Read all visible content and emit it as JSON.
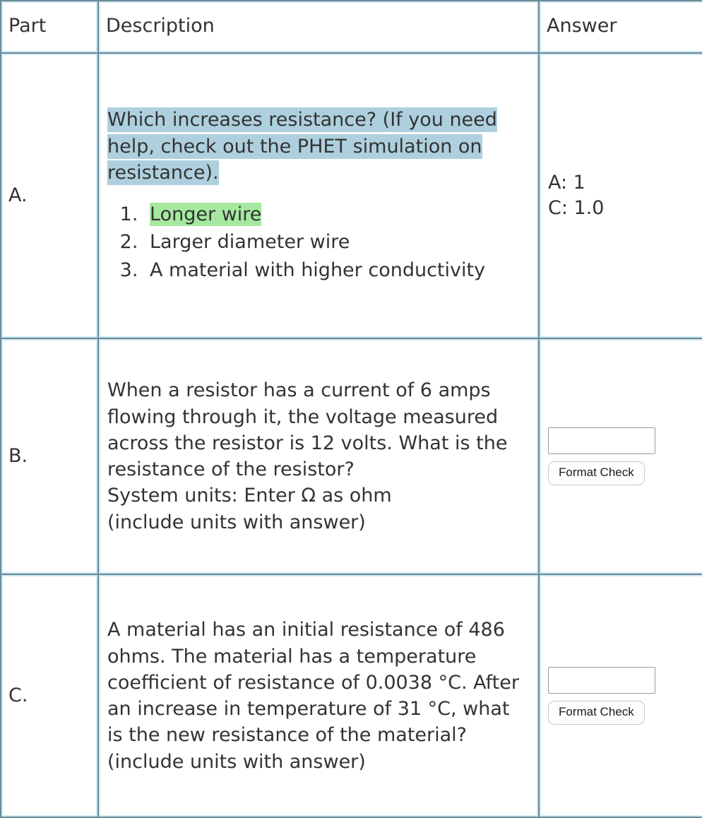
{
  "table": {
    "headers": {
      "part": "Part",
      "description": "Description",
      "answer": "Answer"
    },
    "rows": [
      {
        "part": "A.",
        "description": {
          "prompt": "Which increases resistance? (If you need help, check out the PHET simulation on resistance).",
          "prompt_highlight": "#aed0de",
          "choices": [
            {
              "number": "1.",
              "text": "Longer wire",
              "highlight": "#a5e9a0"
            },
            {
              "number": "2.",
              "text": "Larger diameter wire",
              "highlight": ""
            },
            {
              "number": "3.",
              "text": "A material with higher conductivity",
              "highlight": ""
            }
          ]
        },
        "answer": {
          "type": "static",
          "lines": [
            "A: 1",
            "C: 1.0"
          ]
        }
      },
      {
        "part": "B.",
        "description": {
          "paragraphs": [
            "When a resistor has a current of 6 amps flowing through it, the voltage measured across the resistor is 12 volts. What is the resistance of the resistor?",
            "System units: Enter Ω as ohm",
            "(include units with answer)"
          ]
        },
        "answer": {
          "type": "input",
          "input_value": "",
          "input_placeholder": "",
          "button_label": "Format Check"
        }
      },
      {
        "part": "C.",
        "description": {
          "paragraphs": [
            "A material has an initial resistance of 486 ohms. The material has a temperature coefficient of resistance of 0.0038 °C. After an increase in temperature of 31 °C, what is the new resistance of the material?",
            "(include units with answer)"
          ]
        },
        "answer": {
          "type": "input",
          "input_value": "",
          "input_placeholder": "",
          "button_label": "Format Check"
        }
      }
    ]
  },
  "theme": {
    "text_color": "#333333",
    "border_dark": "#6b8a96",
    "border_light": "#cfe8f3",
    "highlight_blue": "#aed0de",
    "highlight_green": "#a5e9a0"
  }
}
